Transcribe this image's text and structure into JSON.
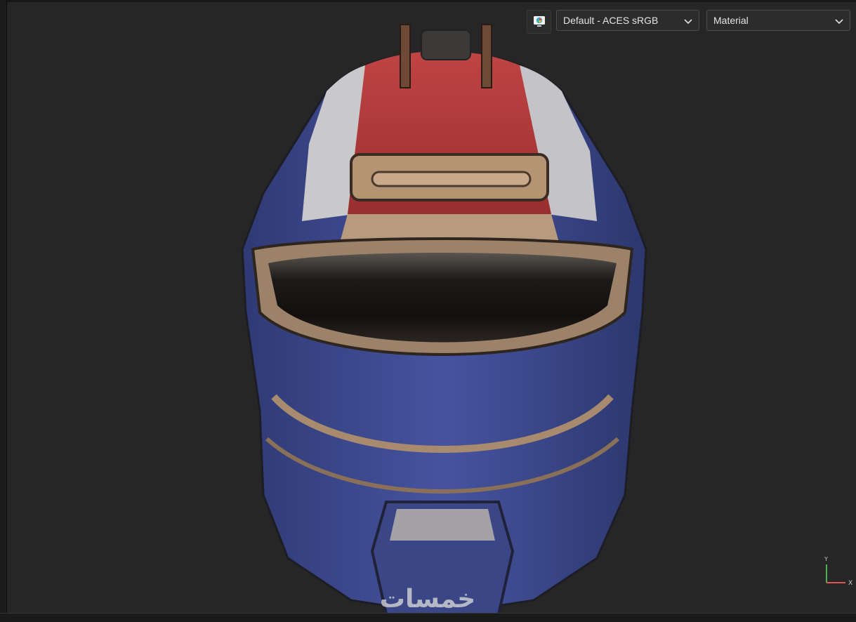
{
  "toolbar": {
    "display_icon": "color-display-icon",
    "colorspace": {
      "selected": "Default - ACES sRGB",
      "icon": "chevron-down-icon"
    },
    "view_mode": {
      "selected": "Material",
      "icon": "chevron-down-icon"
    }
  },
  "viewport": {
    "model": "helmet-3d-model",
    "axis_gizmo": {
      "y_label": "Y",
      "x_label": "X",
      "y_color": "#4caf50",
      "x_color": "#e05555"
    }
  },
  "watermark": {
    "text": "خمسات"
  },
  "colors": {
    "background": "#262626",
    "helmet_blue": "#3d4a8c",
    "helmet_red": "#b03535",
    "helmet_white": "#c9c9cc",
    "helmet_tan": "#a88a6e"
  }
}
